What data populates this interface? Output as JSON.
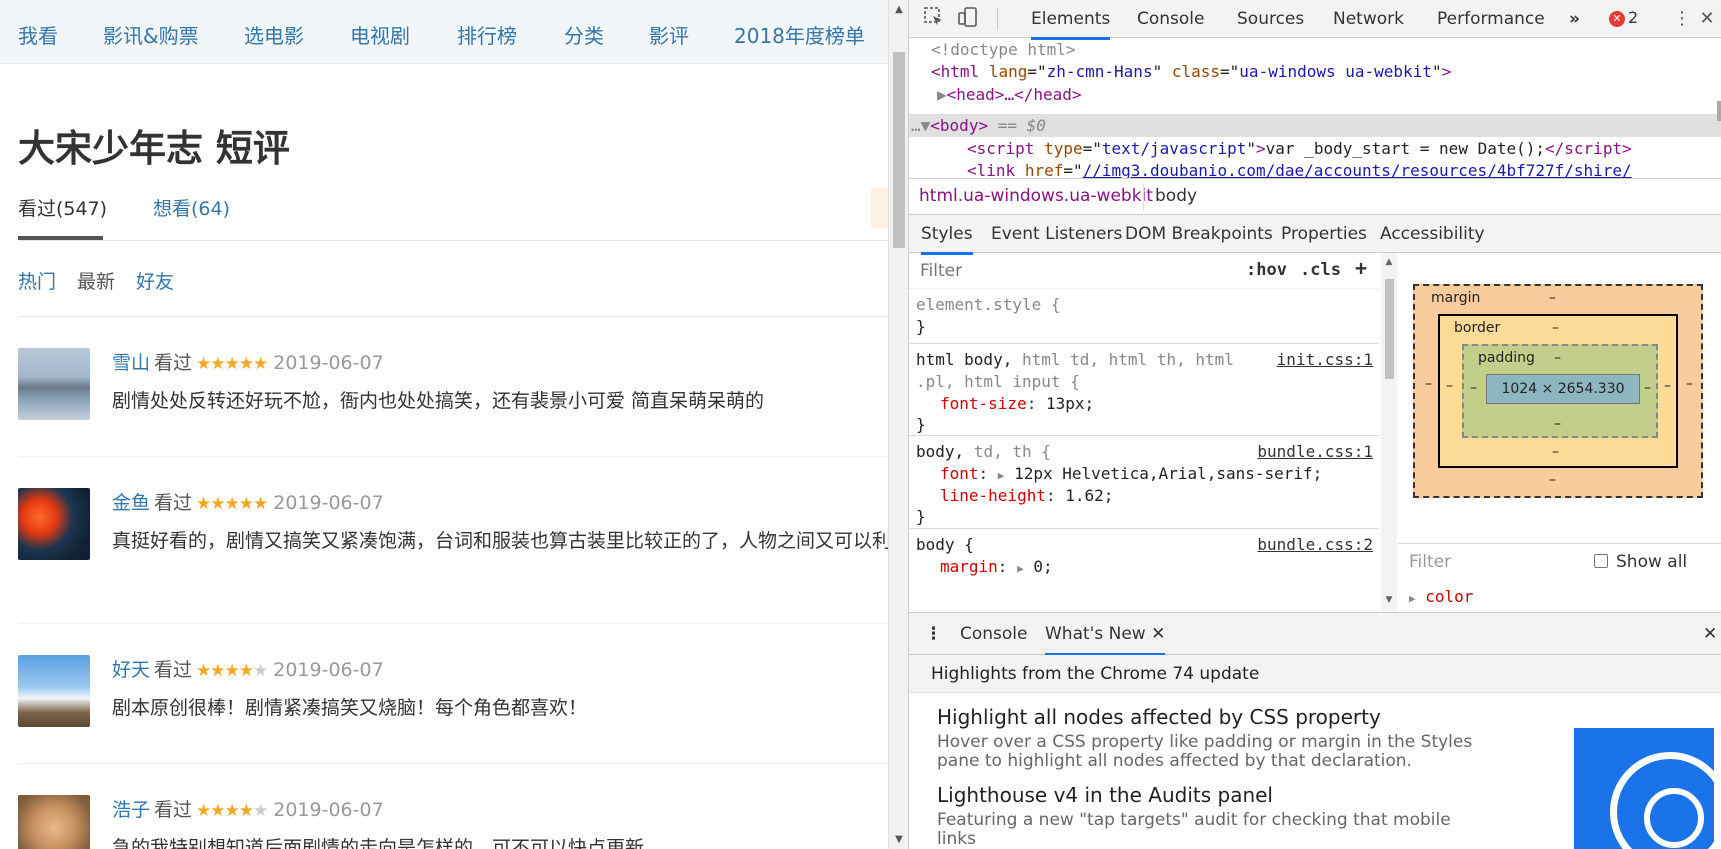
{
  "page": {
    "nav": [
      "我看",
      "影讯&购票",
      "选电影",
      "电视剧",
      "排行榜",
      "分类",
      "影评",
      "2018年度榜单"
    ],
    "title": "大宋少年志 短评",
    "tabs": {
      "seen": "看过(547)",
      "want": "想看(64)"
    },
    "filters": [
      "热门",
      "最新",
      "好友"
    ],
    "comments": [
      {
        "user": "雪山",
        "status": "看过",
        "rating": 5,
        "date": "2019-06-07",
        "text": "剧情处处反转还好玩不尬，衙内也处处搞笑，还有裴景小可爱 简直呆萌呆萌的"
      },
      {
        "user": "金鱼",
        "status": "看过",
        "rating": 5,
        "date": "2019-06-07",
        "text": "真挺好看的，剧情又搞笑又紧凑饱满，台词和服装也算古装里比较正的了，人物之间又可以利"
      },
      {
        "user": "好天",
        "status": "看过",
        "rating": 4,
        "date": "2019-06-07",
        "text": "剧本原创很棒！剧情紧凑搞笑又烧脑！每个角色都喜欢！"
      },
      {
        "user": "浩子",
        "status": "看过",
        "rating": 4,
        "date": "2019-06-07",
        "text": "急的我特别想知道后面剧情的走向是怎样的，可不可以快点更新"
      }
    ]
  },
  "devtools": {
    "tabs": [
      "Elements",
      "Console",
      "Sources",
      "Network",
      "Performance"
    ],
    "more": "»",
    "error_count": "2",
    "dom": {
      "doctype": "<!doctype html>",
      "html_open": {
        "tag": "html",
        "attr1": "lang",
        "val1": "zh-cmn-Hans",
        "attr2": "class",
        "val2": "ua-windows ua-webkit"
      },
      "head": "<head>…</head>",
      "body_marker": "== $0",
      "script_attr": "type",
      "script_val": "text/javascript",
      "script_text": "var _body_start = new Date();",
      "link_attr": "href",
      "link_val": "//img3.doubanio.com/dae/accounts/resources/4bf727f/shire/"
    },
    "breadcrumbs": [
      "html.ua-windows.ua-webkit",
      "body"
    ],
    "subtabs": [
      "Styles",
      "Event Listeners",
      "DOM Breakpoints",
      "Properties",
      "Accessibility"
    ],
    "styles": {
      "filter_placeholder": "Filter",
      "hov": ":hov",
      "cls": ".cls",
      "plus": "+",
      "rules": [
        {
          "selector": "element.style {",
          "props": [],
          "source": ""
        },
        {
          "selector_main": "html body,",
          "selector_rest": " html td, html th, html",
          "selector_line2": ".pl, html input {",
          "props": [
            {
              "name": "font-size",
              "value": "13px;"
            }
          ],
          "source": "init.css:1"
        },
        {
          "selector_main": "body,",
          "selector_rest": " td, th {",
          "props": [
            {
              "name": "font",
              "value": "12px Helvetica,Arial,sans-serif;"
            },
            {
              "name": "line-height",
              "value": "1.62;"
            }
          ],
          "source": "bundle.css:1"
        },
        {
          "selector_main": "body {",
          "props": [
            {
              "name": "margin",
              "value": "0;"
            }
          ],
          "source": "bundle.css:2"
        }
      ]
    },
    "boxmodel": {
      "margin": "margin",
      "border": "border",
      "padding": "padding",
      "content": "1024 × 2654.330",
      "dash": "–"
    },
    "computed": {
      "filter": "Filter",
      "show_all": "Show all",
      "first_prop": "color"
    },
    "drawer": {
      "tabs": [
        "Console",
        "What's New"
      ],
      "header": "Highlights from the Chrome 74 update",
      "items": [
        {
          "title": "Highlight all nodes affected by CSS property",
          "desc": "Hover over a CSS property like padding or margin in the Styles pane to highlight all nodes affected by that declaration."
        },
        {
          "title": "Lighthouse v4 in the Audits panel",
          "desc": "Featuring a new \"tap targets\" audit for checking that mobile links"
        }
      ]
    }
  }
}
